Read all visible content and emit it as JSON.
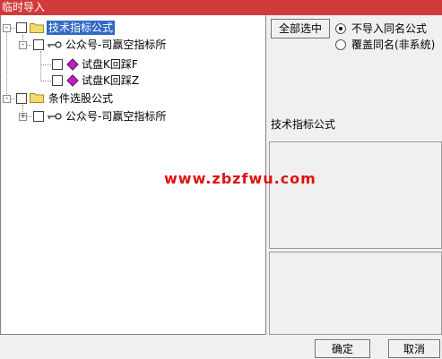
{
  "window": {
    "title": "临时导入"
  },
  "tree": {
    "nodes": [
      {
        "label": "技术指标公式",
        "selected": true
      },
      {
        "label": "公众号-司赢空指标所"
      },
      {
        "label": "试盘K回踩F"
      },
      {
        "label": "试盘K回踩Z"
      },
      {
        "label": "条件选股公式"
      },
      {
        "label": "公众号-司赢空指标所"
      }
    ],
    "expanders": {
      "minus": "-",
      "plus": "+"
    }
  },
  "options": {
    "select_all_label": "全部选中",
    "radios": [
      {
        "label": "不导入同名公式",
        "checked": true
      },
      {
        "label": "覆盖同名(非系统)",
        "checked": false
      }
    ]
  },
  "detail": {
    "title": "技术指标公式"
  },
  "watermark": "www.zbzfwu.com",
  "footer": {
    "ok_label": "确定",
    "cancel_label": "取消"
  },
  "colors": {
    "titlebar": "#d23a3a",
    "selection": "#3169c6",
    "watermark": "#e0100e"
  },
  "icons": {
    "folder": "folder-icon",
    "formula_group": "key-icon",
    "formula": "diamond-icon"
  }
}
